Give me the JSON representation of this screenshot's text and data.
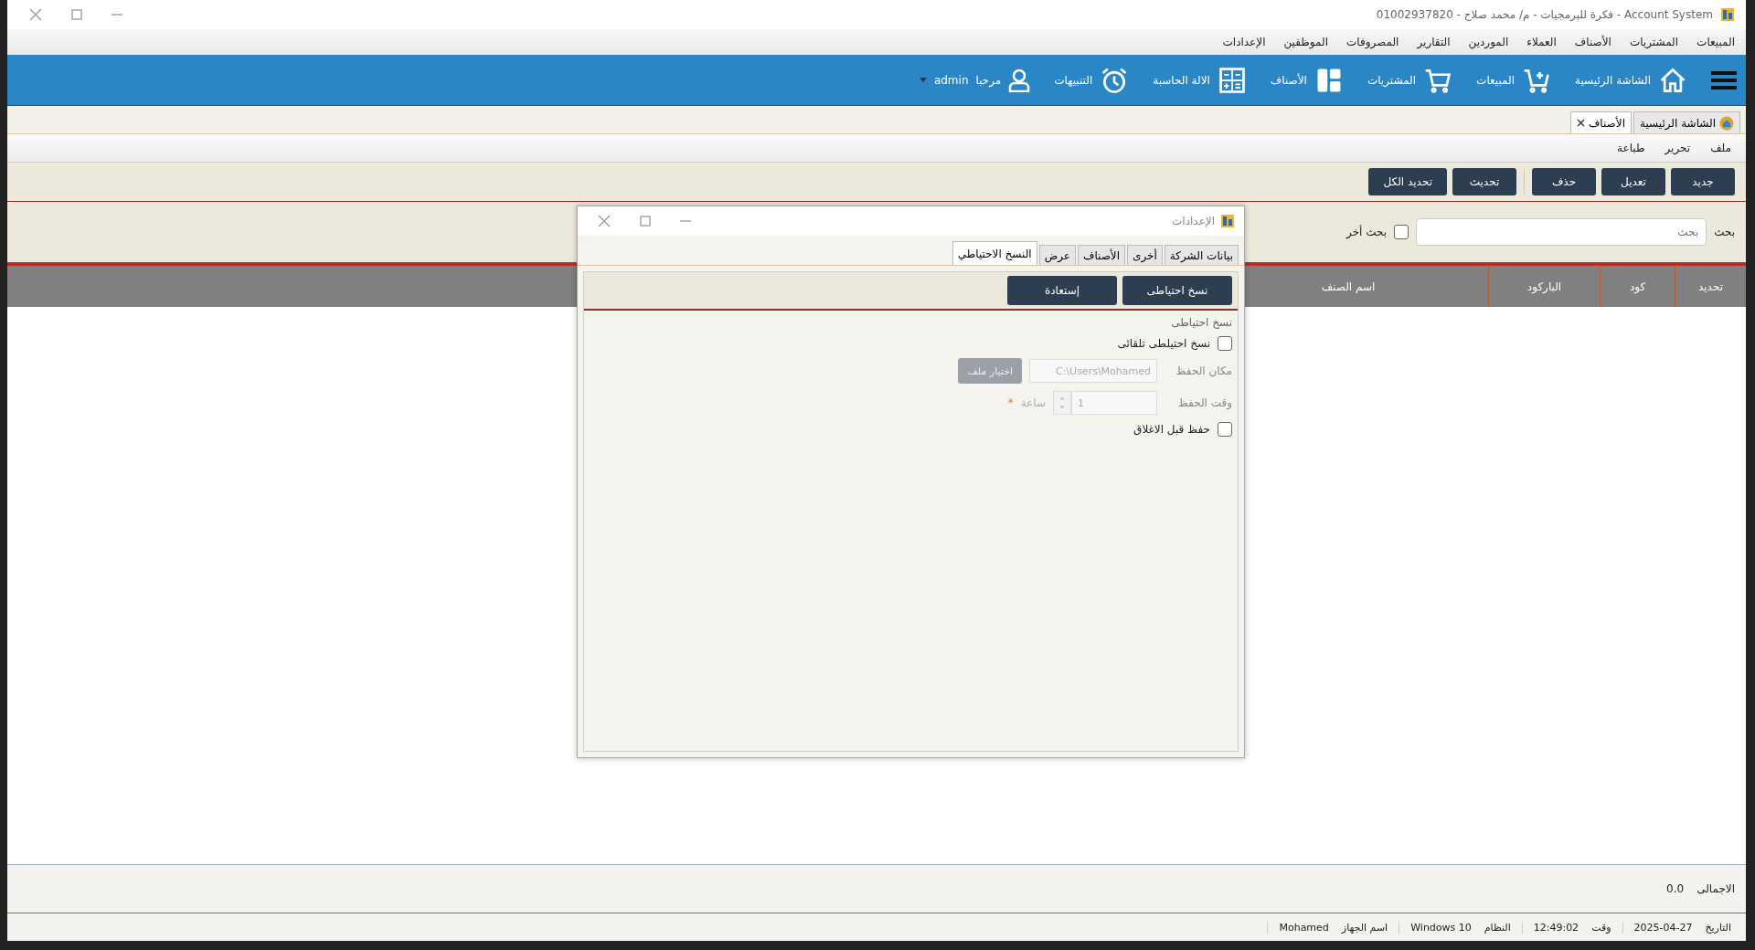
{
  "window": {
    "title": "Account System - فكرة للبرمجيات - م/ محمد صلاح - 01002937820"
  },
  "menu_bar": [
    "المبيعات",
    "المشتريات",
    "الأصناف",
    "العملاء",
    "الموردين",
    "التقارير",
    "المصروفات",
    "الموظفين",
    "الإعدادات"
  ],
  "toolbar": [
    {
      "kind": "home",
      "label": "الشاشة الرئيسية"
    },
    {
      "kind": "cart-plus",
      "label": "المبيعات"
    },
    {
      "kind": "cart",
      "label": "المشتريات"
    },
    {
      "kind": "layout",
      "label": "الأصناف"
    },
    {
      "kind": "calculator",
      "label": "الالة الحاسبة"
    },
    {
      "kind": "alarm",
      "label": "التنبيهات"
    }
  ],
  "user": {
    "greeting": "مرحبا",
    "name": "admin"
  },
  "doc_tabs": [
    {
      "label": "الشاشة الرئيسية",
      "selected": false,
      "closable": false
    },
    {
      "label": "الأصناف",
      "selected": true,
      "closable": true
    }
  ],
  "file_menu": [
    "ملف",
    "تحرير",
    "طباعة"
  ],
  "actions": [
    {
      "label": "جديد",
      "separated": false
    },
    {
      "label": "تعديل",
      "separated": false
    },
    {
      "label": "حذف",
      "separated": false
    },
    {
      "label": "تحديث",
      "separated": true
    },
    {
      "label": "تحديد الكل",
      "separated": false
    }
  ],
  "search": {
    "label": "بحث",
    "placeholder": "بحث",
    "other_label": "بحث أخر",
    "other_checked": false
  },
  "table": {
    "columns": [
      "تحديد",
      "كود",
      "الباركود",
      "اسم الصنف"
    ]
  },
  "total": {
    "label": "الاجمالى",
    "value": "0.0"
  },
  "status_bar": [
    {
      "label": "التاريخ",
      "value": "2025-04-27"
    },
    {
      "label": "وقت",
      "value": "12:49:02"
    },
    {
      "label": "النظام",
      "value": "Windows 10"
    },
    {
      "label": "اسم الجهاز",
      "value": "Mohamed"
    }
  ],
  "dialog": {
    "title": "الإعدادات",
    "tabs": [
      {
        "label": "بيانات الشركة",
        "selected": false
      },
      {
        "label": "أخرى",
        "selected": false
      },
      {
        "label": "الأصناف",
        "selected": false
      },
      {
        "label": "عرض",
        "selected": false
      },
      {
        "label": "النسخ الاحتياطي",
        "selected": true
      }
    ],
    "buttons": [
      "نسخ احتياطى",
      "إستعادة"
    ],
    "section": "نسخ احتياطى",
    "auto_backup": {
      "label": "نسخ احتيلطى تلقائى",
      "checked": false
    },
    "location": {
      "label": "مكان الحفظ",
      "value": "C:\\Users\\Mohamed",
      "button": "اختيار ملف",
      "disabled": true
    },
    "interval": {
      "label": "وقت الحفظ",
      "value": "1",
      "unit": "ساعة",
      "required_mark": "*",
      "disabled": true
    },
    "save_on_close": {
      "label": "حفظ قبل الاغلاق",
      "checked": false
    }
  }
}
